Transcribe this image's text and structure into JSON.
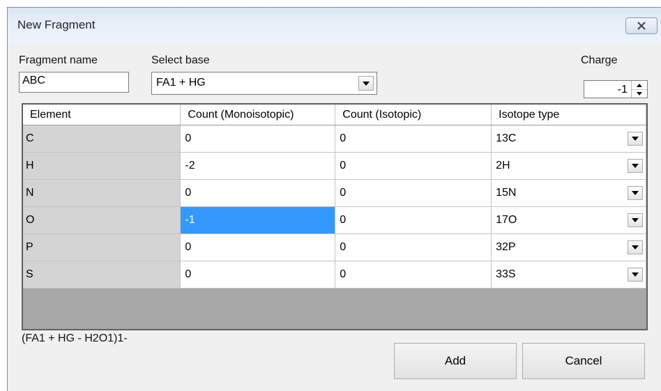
{
  "window": {
    "title": "New Fragment"
  },
  "fragment_name": {
    "label": "Fragment name",
    "value": "ABC"
  },
  "select_base": {
    "label": "Select base",
    "value": "FA1 + HG"
  },
  "charge": {
    "label": "Charge",
    "value": "-1"
  },
  "table": {
    "columns": [
      "Element",
      "Count (Monoisotopic)",
      "Count (Isotopic)",
      "Isotope type"
    ],
    "rows": [
      {
        "element": "C",
        "mono": "0",
        "iso": "0",
        "isotope": "13C"
      },
      {
        "element": "H",
        "mono": "-2",
        "iso": "0",
        "isotope": "2H"
      },
      {
        "element": "N",
        "mono": "0",
        "iso": "0",
        "isotope": "15N"
      },
      {
        "element": "O",
        "mono": "-1",
        "iso": "0",
        "isotope": "17O"
      },
      {
        "element": "P",
        "mono": "0",
        "iso": "0",
        "isotope": "32P"
      },
      {
        "element": "S",
        "mono": "0",
        "iso": "0",
        "isotope": "33S"
      }
    ],
    "selected_row": 3,
    "selected_column": "mono"
  },
  "formula": "(FA1 + HG - H2O1)1-",
  "buttons": {
    "add": "Add",
    "cancel": "Cancel"
  },
  "colors": {
    "selection": "#3399ff",
    "element_cell": "#d4d4d4",
    "grid_background": "#a8a8a8"
  }
}
